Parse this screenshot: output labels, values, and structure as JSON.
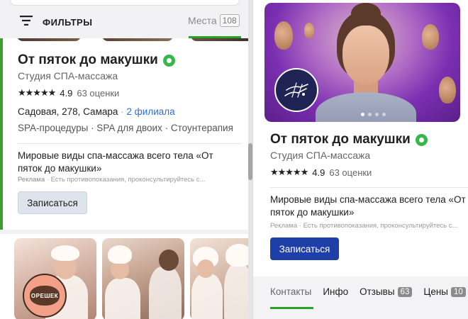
{
  "toolbar": {
    "filter_label": "ФИЛЬТРЫ",
    "places_label": "Места",
    "places_count": "108"
  },
  "left_card": {
    "title": "От пяток до макушки",
    "subtitle": "Студия СПА-массажа",
    "stars": "★★★★★",
    "rating": "4.9",
    "reviews": "63 оценки",
    "address": "Садовая, 278, Самара",
    "separator": "·",
    "branches": "2 филиала",
    "tags": "SPA-процедуры · SPA для двоих · Стоунтерапия",
    "ad_text": "Мировые виды спа-массажа всего тела «От пяток до макушки»",
    "ad_label": "Реклама",
    "ad_disclaimer": "Есть противопоказания, проконсультируйтесь с...",
    "book_label": "Записаться"
  },
  "left_card2": {
    "logo_text": "ОРЕШЕК"
  },
  "right_panel": {
    "title": "От пяток до макушки",
    "subtitle": "Студия СПА-массажа",
    "stars": "★★★★★",
    "rating": "4.9",
    "reviews": "63 оценки",
    "ad_text_line1": "Мировые виды спа-массажа всего тела «От",
    "ad_text_line2": "пяток до макушки»",
    "ad_label": "Реклама",
    "ad_disclaimer": "Есть противопоказания, проконсультируйтесь с...",
    "book_label": "Записаться",
    "tabs": [
      {
        "label": "Контакты"
      },
      {
        "label": "Инфо"
      },
      {
        "label": "Отзывы",
        "badge": "63"
      },
      {
        "label": "Цены",
        "badge": "10"
      }
    ]
  },
  "colors": {
    "accent_green": "#27a327",
    "verified_green": "#39b54a",
    "primary_button": "#1e3ea8",
    "link_blue": "#2f6fd6"
  },
  "icons": [
    "filter-icon",
    "verified-icon",
    "massage-hands-icon"
  ]
}
